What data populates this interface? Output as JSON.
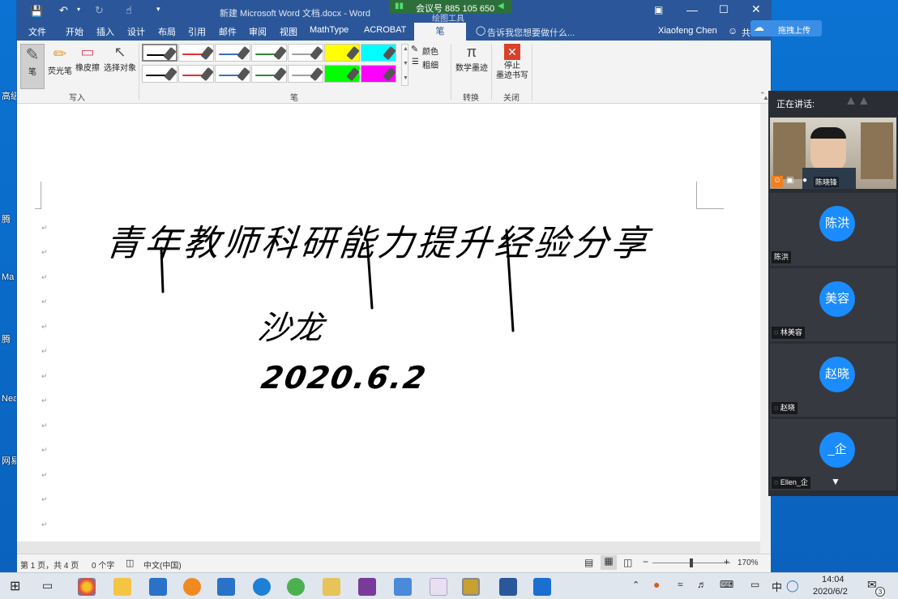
{
  "desktop": {
    "icons": [
      "高级",
      "腾",
      "Ma",
      "腾",
      "Nea",
      "网易"
    ]
  },
  "word": {
    "title": "新建 Microsoft Word 文档.docx - Word",
    "meeting_id": "会议号 885 105 650",
    "context_tab": "绘图工具",
    "tabs": [
      "文件",
      "开始",
      "插入",
      "设计",
      "布局",
      "引用",
      "邮件",
      "审阅",
      "视图",
      "MathType",
      "ACROBAT"
    ],
    "active_tab": "笔",
    "tell_me": "告诉我您想要做什么...",
    "user": "Xiaofeng Chen",
    "share": "共",
    "upload_label": "拖拽上传",
    "ribbon": {
      "write_tools": [
        "笔",
        "荧光笔",
        "橡皮擦",
        "选择对象"
      ],
      "write_group": "写入",
      "pen_group": "笔",
      "color_label": "颜色",
      "weight_label": "粗细",
      "math_ink": "数学墨迹",
      "convert_group": "转换",
      "stop_inking": "停止\n墨迹书写",
      "close_group": "关闭",
      "pen_colors": [
        "#000000",
        "#e03030",
        "#3a6ec8",
        "#2a8a3a",
        "#a0a0a0",
        "#ffff00",
        "#00ffff",
        "#000000",
        "#e03030",
        "#3a6ec8",
        "#2a8a3a",
        "#a0a0a0",
        "#00ff00",
        "#ff00ff"
      ]
    },
    "status": {
      "page": "第 1 页，共 4 页",
      "words": "0 个字",
      "lang": "中文(中国)",
      "zoom": "170%"
    },
    "ink": {
      "line1": "青年教师科研能力提升经验分享",
      "line2": "沙龙",
      "line3": "2020.6.2"
    }
  },
  "meeting": {
    "speaking_label": "正在讲话:",
    "speaker_name": "陈晓锋",
    "participants": [
      {
        "avatar": "陈洪",
        "name": "陈洪"
      },
      {
        "avatar": "美容",
        "name": "林美容"
      },
      {
        "avatar": "赵晓",
        "name": "赵晓"
      },
      {
        "avatar": "_企",
        "name": "Ellen_企"
      }
    ]
  },
  "taskbar": {
    "ime": "中",
    "time": "14:04",
    "date": "2020/6/2",
    "notifications": "3"
  }
}
